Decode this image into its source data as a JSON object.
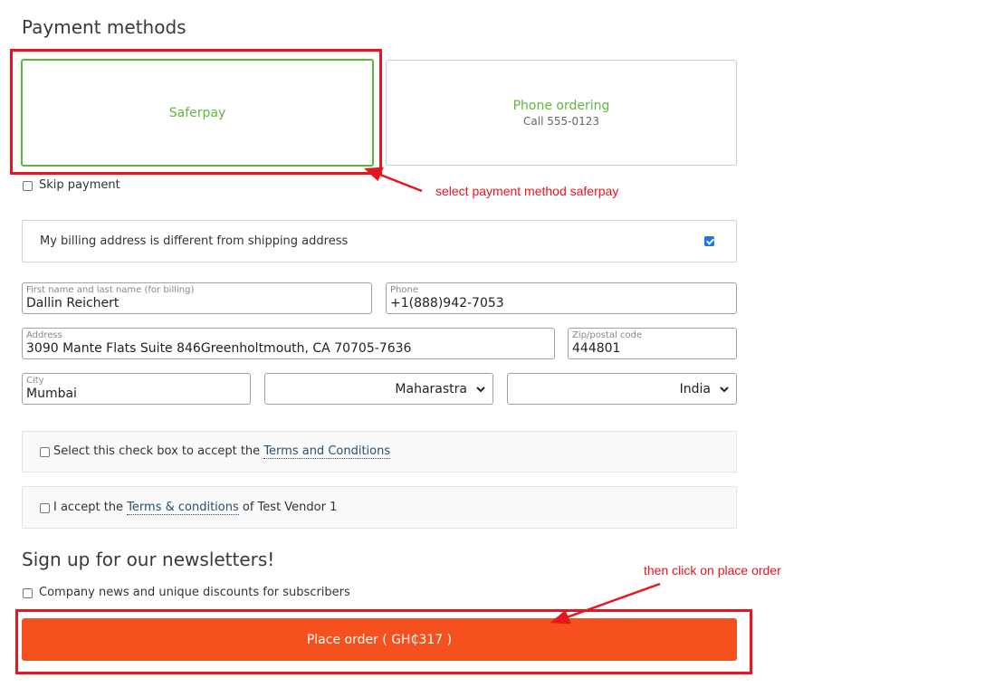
{
  "payment": {
    "heading": "Payment methods",
    "methods": [
      {
        "title": "Saferpay",
        "subtitle": "",
        "selected": true
      },
      {
        "title": "Phone ordering",
        "subtitle": "Call 555-0123",
        "selected": false
      }
    ],
    "skip_label": "Skip payment"
  },
  "billing": {
    "different_label": "My billing address is different from shipping address",
    "different_checked": true,
    "fields": {
      "name": {
        "label": "First name and last name (for billing)",
        "value": "Dallin Reichert"
      },
      "phone": {
        "label": "Phone",
        "value": "+1(888)942-7053"
      },
      "address": {
        "label": "Address",
        "value": "3090 Mante Flats Suite 846Greenholtmouth, CA 70705-7636"
      },
      "zip": {
        "label": "Zip/postal code",
        "value": "444801"
      },
      "city": {
        "label": "City",
        "value": "Mumbai"
      },
      "state": {
        "value": "Maharastra"
      },
      "country": {
        "value": "India"
      }
    }
  },
  "terms": {
    "general": {
      "prefix": "Select this check box to accept the ",
      "link": "Terms and Conditions"
    },
    "vendor": {
      "prefix": "I accept the ",
      "link": "Terms & conditions",
      "suffix": " of Test Vendor 1"
    }
  },
  "newsletter": {
    "heading": "Sign up for our newsletters!",
    "option_label": "Company news and unique discounts for subscribers"
  },
  "place_order": {
    "label": "Place order ( GH₵317 )"
  },
  "annotations": {
    "saferpay_note": "select payment method saferpay",
    "place_order_note": "then click on place order",
    "color": "#e8141e"
  },
  "colors": {
    "accent_green": "#5cb83c",
    "button_orange": "#f4511e",
    "checkbox_blue": "#1a73e8"
  }
}
